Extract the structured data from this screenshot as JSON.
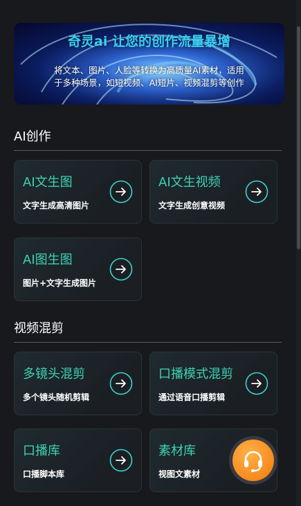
{
  "banner": {
    "title": "奇灵ai 让您的创作流量暴增",
    "desc_line1": "将文本、图片、人脸等转换为高质量AI素材，适用",
    "desc_line2": "于多种场景，如短视频、AI短片、视频混剪等创作"
  },
  "sections": [
    {
      "title": "AI创作",
      "cards": [
        {
          "title": "AI文生图",
          "sub": "文字生成高清图片"
        },
        {
          "title": "AI文生视频",
          "sub": "文字生成创意视频"
        },
        {
          "title": "AI图生图",
          "sub": "图片+文字生成图片"
        }
      ]
    },
    {
      "title": "视频混剪",
      "cards": [
        {
          "title": "多镜头混剪",
          "sub": "多个镜头随机剪辑"
        },
        {
          "title": "口播模式混剪",
          "sub": "通过语音口播剪辑"
        },
        {
          "title": "口播库",
          "sub": "口播脚本库"
        },
        {
          "title": "素材库",
          "sub": "视图文素材"
        }
      ]
    }
  ],
  "icons": {
    "card_arrow": "arrow-right-circle-icon",
    "support": "headset-icon"
  },
  "colors": {
    "background": "#18191d",
    "accent_teal": "#3fd1b4",
    "banner_title": "#39d0f4",
    "support_orange": "#f78a1c"
  }
}
